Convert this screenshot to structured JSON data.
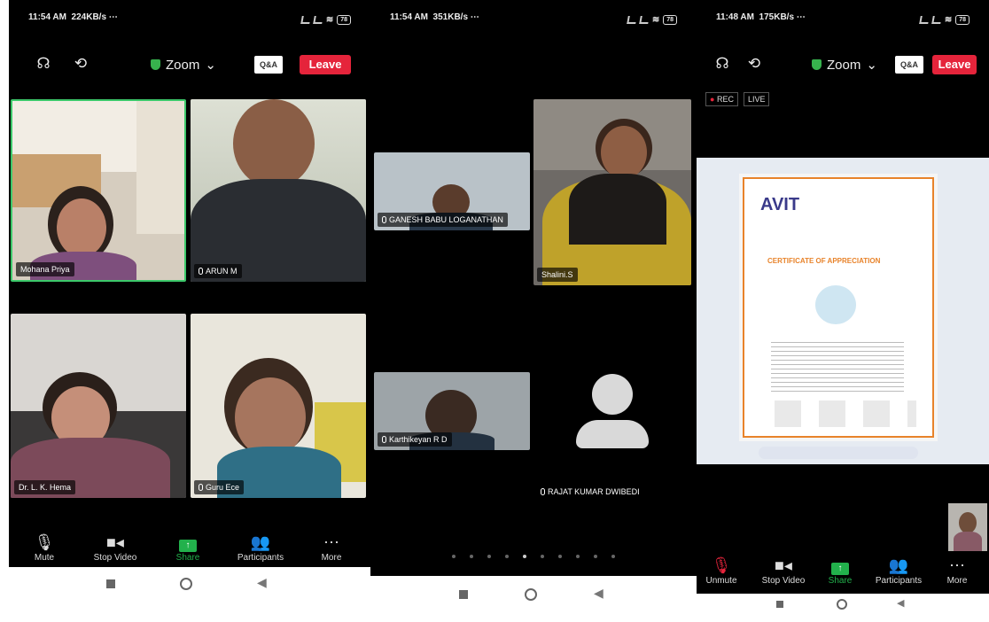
{
  "phone1": {
    "status": {
      "time": "11:54 AM",
      "speed": "224KB/s",
      "extra": "⋯",
      "battery": "78"
    },
    "zoom_label": "Zoom",
    "qa_label": "Q&A",
    "leave_label": "Leave",
    "participants": [
      {
        "name": "Mohana Priya",
        "active": true
      },
      {
        "name": "ARUN M"
      },
      {
        "name": "Dr. L. K. Hema"
      },
      {
        "name": "Guru Ece"
      }
    ],
    "toolbar": {
      "mute": "Mute",
      "stop_video": "Stop Video",
      "share": "Share",
      "participants": "Participants",
      "more": "More"
    }
  },
  "phone2": {
    "status": {
      "time": "11:54 AM",
      "speed": "351KB/s",
      "extra": "⋯",
      "battery": "78"
    },
    "participants": [
      {
        "name": "GANESH BABU LOGANATHAN"
      },
      {
        "name": "Shalini.S"
      },
      {
        "name": "Karthikeyan R D"
      },
      {
        "name": "RAJAT KUMAR DWIBEDI"
      }
    ],
    "page_dots": 10,
    "active_dot": 4
  },
  "phone3": {
    "status": {
      "time": "11:48 AM",
      "speed": "175KB/s",
      "extra": "⋯",
      "battery": "78"
    },
    "zoom_label": "Zoom",
    "qa_label": "Q&A",
    "leave_label": "Leave",
    "rec_label": "REC",
    "live_label": "LIVE",
    "certificate": {
      "logo": "AVIT",
      "title": "CERTIFICATE OF APPRECIATION"
    },
    "toolbar": {
      "unmute": "Unmute",
      "stop_video": "Stop Video",
      "share": "Share",
      "participants": "Participants",
      "more": "More"
    }
  },
  "colors": {
    "leave": "#e5243b",
    "share": "#22b14c",
    "active_border": "#3cc86a",
    "certificate_accent": "#e8832a"
  }
}
